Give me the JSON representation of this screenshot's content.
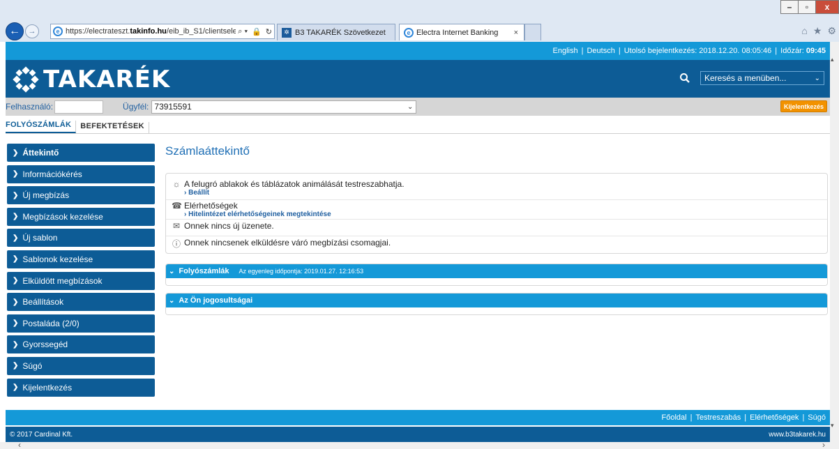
{
  "browser": {
    "url_prefix": "https://electrateszt.",
    "url_domain": "takinfo.hu",
    "url_path": "/eib_ib_S1/clientselec",
    "tabs": [
      {
        "label": "B3 TAKARÉK Szövetkezet"
      },
      {
        "label": "Electra Internet Banking",
        "close": "×"
      }
    ],
    "window": {
      "minimize": "–",
      "maximize": "▫",
      "close": "x"
    }
  },
  "topbar": {
    "english": "English",
    "deutsch": "Deutsch",
    "last_login_label": "Utolsó bejelentkezés: 2018.12.20. 08:05:46",
    "timer_label": "Időzár:",
    "timer_value": "09:45"
  },
  "header": {
    "logo": "TAKARÉK",
    "search_placeholder": "Keresés a menüben..."
  },
  "userbar": {
    "user_label": "Felhasználó:",
    "client_label": "Ügyfél:",
    "client_value": "73915591",
    "logout": "Kijelentkezés"
  },
  "modtabs": [
    "FOLYÓSZÁMLÁK",
    "BEFEKTETÉSEK"
  ],
  "sidebar": {
    "items": [
      {
        "label": "Áttekintő"
      },
      {
        "label": "Információkérés"
      },
      {
        "label": "Új megbízás"
      },
      {
        "label": "Megbízások kezelése"
      },
      {
        "label": "Új sablon"
      },
      {
        "label": "Sablonok kezelése"
      },
      {
        "label": "Elküldött megbízások"
      },
      {
        "label": "Beállítások"
      },
      {
        "label": "Postaláda (2/0)"
      },
      {
        "label": "Gyorssegéd"
      },
      {
        "label": "Súgó"
      },
      {
        "label": "Kijelentkezés"
      }
    ]
  },
  "main": {
    "title": "Számlaáttekintő",
    "info": {
      "animation_text": "A felugró ablakok és táblázatok animálását testreszabhatja.",
      "animation_link": "› Beállít",
      "contacts_text": "Elérhetőségek",
      "contacts_link": "› Hitelintézet elérhetőségeinek megtekintése",
      "messages_text": "Onnek nincs új üzenete.",
      "packages_text": "Onnek nincsenek elküldésre váró megbízási csomagjai."
    },
    "panels": {
      "accounts_title": "Folyószámlák",
      "accounts_sub": "Az egyenleg időpontja: 2019.01.27. 12:16:53",
      "rights_title": "Az Ön jogosultságai"
    }
  },
  "footer": {
    "links": [
      "Főoldal",
      "Testreszabás",
      "Elérhetőségek",
      "Súgó"
    ],
    "copyright": "© 2017 Cardinal Kft.",
    "site": "www.b3takarek.hu"
  },
  "colors": {
    "brand_dark": "#0d5c96",
    "brand_light": "#1499d8",
    "accent_orange": "#f29200"
  }
}
